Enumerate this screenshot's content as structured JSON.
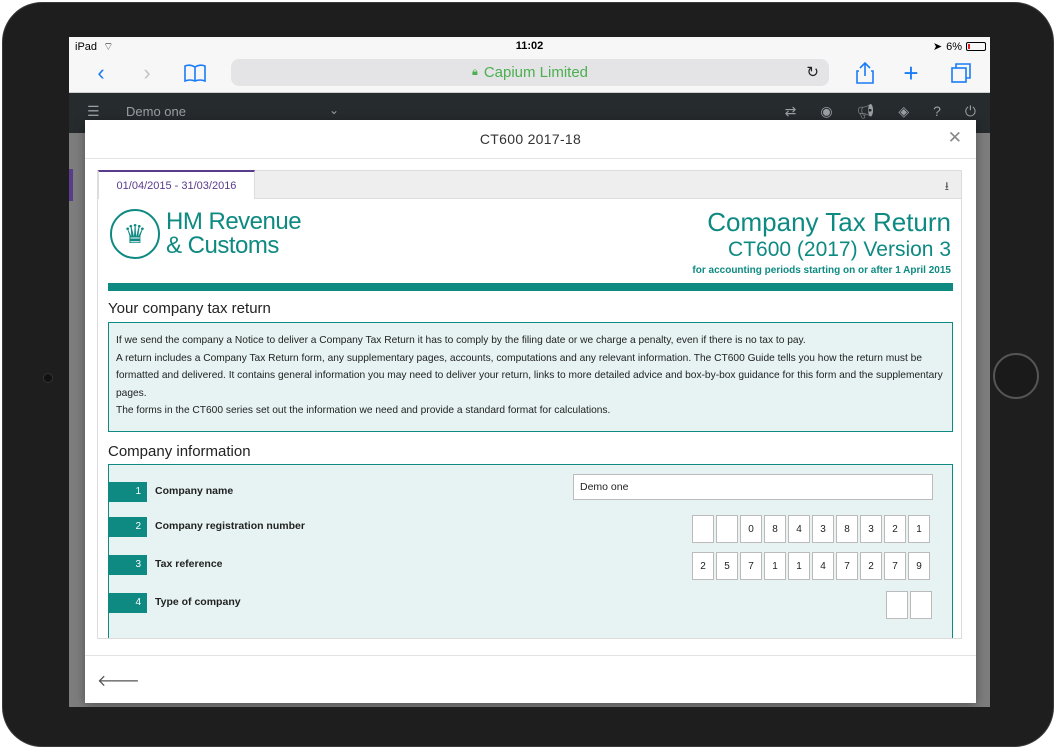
{
  "status_bar": {
    "device": "iPad",
    "time": "11:02",
    "battery": "6%"
  },
  "browser": {
    "site_name": "Capium Limited"
  },
  "app": {
    "company_selector": "Demo one"
  },
  "modal": {
    "title": "CT600 2017-18",
    "tab_label": "01/04/2015 - 31/03/2016"
  },
  "form": {
    "org_line1": "HM Revenue",
    "org_line2": "& Customs",
    "title": "Company Tax Return",
    "subtitle": "CT600 (2017) Version 3",
    "period_note": "for accounting periods starting on or after 1 April 2015",
    "section1_heading": "Your company tax return",
    "paragraphs": [
      "If we send the company a Notice to deliver a Company Tax Return it has to comply by the filing date or we charge a penalty, even if there is no tax to pay.",
      "A return includes a Company Tax Return form, any supplementary pages, accounts, computations and any relevant information. The CT600 Guide tells you how the return must be formatted and delivered. It contains general information you may need to deliver your return, links to more detailed advice and box-by-box guidance for this form and the supplementary pages.",
      "The forms in the CT600 series set out the information we need and provide a standard format for calculations."
    ],
    "section2_heading": "Company information",
    "rows": [
      {
        "num": "1",
        "label": "Company name",
        "value": "Demo one"
      },
      {
        "num": "2",
        "label": "Company registration number",
        "digits": [
          "",
          "",
          "0",
          "8",
          "4",
          "3",
          "8",
          "3",
          "2",
          "1"
        ]
      },
      {
        "num": "3",
        "label": "Tax reference",
        "digits": [
          "2",
          "5",
          "7",
          "1",
          "1",
          "4",
          "7",
          "2",
          "7",
          "9"
        ]
      },
      {
        "num": "4",
        "label": "Type of company",
        "digits": [
          "",
          ""
        ]
      }
    ]
  },
  "colors": {
    "brand_teal": "#0e8a82",
    "accent_purple": "#5a3b8c",
    "safari_blue": "#1a7cf5"
  }
}
